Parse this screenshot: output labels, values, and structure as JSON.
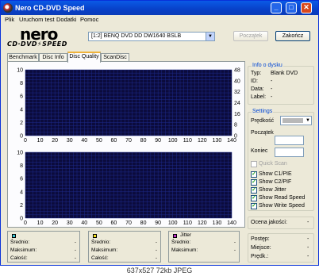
{
  "window": {
    "title": "Nero CD-DVD Speed",
    "controls": {
      "minimize": "_",
      "maximize": "□",
      "close": "✕"
    }
  },
  "menu": [
    "Plik",
    "Uruchom test",
    "Dodatki",
    "Pomoc"
  ],
  "logo": {
    "top": "nero",
    "bottom": "CD·DVD⚡SPEED"
  },
  "drive": {
    "value": "[1:2]  BENQ DVD DD DW1640 BSLB"
  },
  "buttons": {
    "start": "Początek",
    "end": "Zakończ"
  },
  "tabs": [
    "Benchmark",
    "Disc Info",
    "Disc Quality",
    "ScanDisc"
  ],
  "active_tab": "Disc Quality",
  "chart_data": [
    {
      "type": "line",
      "title": "",
      "xlabel": "",
      "ylabel": "",
      "xlim": [
        0,
        140
      ],
      "ylim": [
        0,
        10
      ],
      "y2lim": [
        0,
        48
      ],
      "x_ticks": [
        0,
        10,
        20,
        30,
        40,
        50,
        60,
        70,
        80,
        90,
        100,
        110,
        120,
        130,
        140
      ],
      "y_ticks": [
        0,
        2,
        4,
        6,
        8,
        10
      ],
      "y2_ticks": [
        0,
        8,
        16,
        24,
        32,
        40,
        48
      ],
      "grid": true,
      "series": []
    },
    {
      "type": "line",
      "title": "",
      "xlabel": "",
      "ylabel": "",
      "xlim": [
        0,
        140
      ],
      "ylim": [
        0,
        10
      ],
      "x_ticks": [
        0,
        10,
        20,
        30,
        40,
        50,
        60,
        70,
        80,
        90,
        100,
        110,
        120,
        130,
        140
      ],
      "y_ticks": [
        0,
        2,
        4,
        6,
        8,
        10
      ],
      "grid": true,
      "series": []
    }
  ],
  "disc_info": {
    "title": "Info o dysku",
    "rows": [
      {
        "label": "Typ:",
        "value": "Blank DVD"
      },
      {
        "label": "ID:",
        "value": "-"
      },
      {
        "label": "Data:",
        "value": "-"
      },
      {
        "label": "Label:",
        "value": "-"
      }
    ]
  },
  "settings": {
    "title": "Settings",
    "speed_label": "Prędkość",
    "start_label": "Początek",
    "end_label": "Koniec",
    "quick_scan": "Quick Scan",
    "checks": [
      {
        "label": "Show C1/PIE",
        "checked": true
      },
      {
        "label": "Show C2/PIF",
        "checked": true
      },
      {
        "label": "Show Jitter",
        "checked": true
      },
      {
        "label": "Show Read Speed",
        "checked": true
      },
      {
        "label": "Show Write Speed",
        "checked": true
      }
    ]
  },
  "quality": {
    "label": "Ocena jakości:",
    "value": "-"
  },
  "progress": {
    "rows": [
      {
        "label": "Postęp:",
        "value": "-"
      },
      {
        "label": "Miejsce:",
        "value": "-"
      },
      {
        "label": "Prędk.:",
        "value": "-"
      }
    ]
  },
  "stats": [
    {
      "color": "#3ec8d8",
      "title": "",
      "rows": [
        {
          "label": "Średnio:",
          "value": "-"
        },
        {
          "label": "Maksimum:",
          "value": "-"
        },
        {
          "label": "Całość:",
          "value": "-"
        }
      ]
    },
    {
      "color": "#f5e21c",
      "title": "",
      "rows": [
        {
          "label": "Średnio:",
          "value": "-"
        },
        {
          "label": "Maksimum:",
          "value": "-"
        },
        {
          "label": "Całość:",
          "value": "-"
        }
      ]
    },
    {
      "color": "#c030c8",
      "title": "Jitter",
      "rows": [
        {
          "label": "Średnio:",
          "value": "-"
        },
        {
          "label": "Maksimum:",
          "value": "-"
        }
      ]
    }
  ],
  "caption": "637x527 72kb JPEG"
}
